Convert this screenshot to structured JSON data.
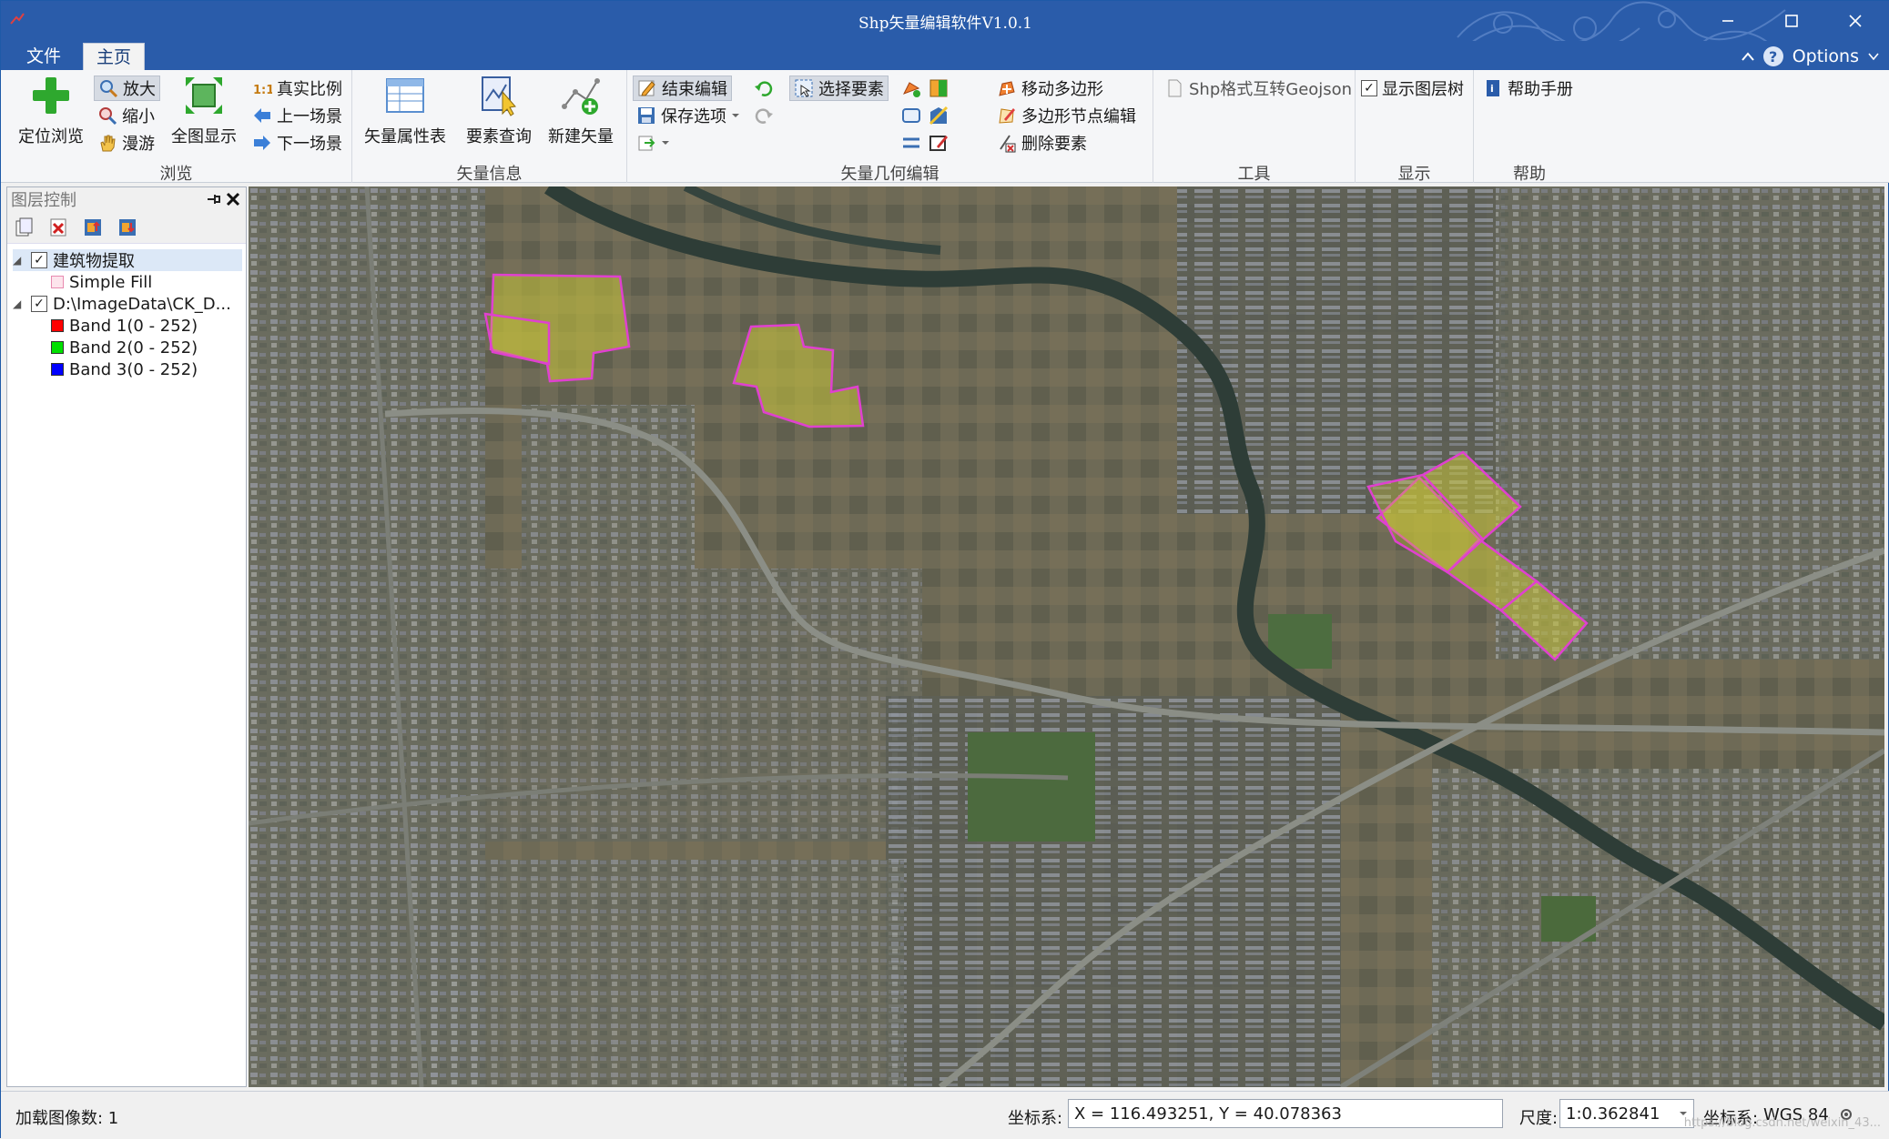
{
  "window": {
    "title": "Shp矢量编辑软件V1.0.1"
  },
  "menu": {
    "tabs": [
      {
        "label": "文件",
        "active": false
      },
      {
        "label": "主页",
        "active": true
      }
    ],
    "options_label": "Options"
  },
  "ribbon": {
    "browse": {
      "group_label": "浏览",
      "locate_label": "定位浏览",
      "zoom_in_label": "放大",
      "zoom_out_label": "缩小",
      "pan_label": "漫游",
      "full_extent_label": "全图显示",
      "true_scale_label": "真实比例",
      "prev_scene_label": "上一场景",
      "next_scene_label": "下一场景"
    },
    "vector_info": {
      "group_label": "矢量信息",
      "attribute_table_label": "矢量属性表",
      "feature_query_label": "要素查询",
      "new_vector_label": "新建矢量"
    },
    "geometry_edit": {
      "group_label": "矢量几何编辑",
      "end_edit_label": "结束编辑",
      "save_options_label": "保存选项",
      "select_feature_label": "选择要素",
      "move_polygon_label": "移动多边形",
      "polygon_node_edit_label": "多边形节点编辑",
      "delete_feature_label": "删除要素"
    },
    "tools": {
      "group_label": "工具",
      "shp_geojson_label": "Shp格式互转Geojson"
    },
    "display": {
      "group_label": "显示",
      "show_layer_tree_label": "显示图层树",
      "show_layer_tree_checked": true
    },
    "help": {
      "group_label": "帮助",
      "manual_label": "帮助手册"
    }
  },
  "layer_panel": {
    "title": "图层控制",
    "layers": [
      {
        "name": "建筑物提取",
        "checked": true,
        "selected": true,
        "legend": [
          {
            "label": "Simple Fill",
            "color": "#fde4ec"
          }
        ]
      },
      {
        "name": "D:\\ImageData\\CK_D...",
        "checked": true,
        "selected": false,
        "legend": [
          {
            "label": "Band 1(0 - 252)",
            "color": "#ff0000"
          },
          {
            "label": "Band 2(0 - 252)",
            "color": "#00e000"
          },
          {
            "label": "Band 3(0 - 252)",
            "color": "#0000ff"
          }
        ]
      }
    ]
  },
  "status": {
    "loaded_images": "加载图像数: 1",
    "coord_label": "坐标系:",
    "coord_value": "X = 116.493251, Y = 40.078363",
    "scale_label": "尺度:",
    "scale_value": "1:0.362841",
    "crs_label": "坐标系:",
    "crs_value": "WGS 84",
    "watermark": "https://blog.csdn.net/weixin_43..."
  },
  "colors": {
    "titlebar": "#2a5caa",
    "polygon_outline": "#e040d0",
    "polygon_fill": "#c9c43a"
  }
}
